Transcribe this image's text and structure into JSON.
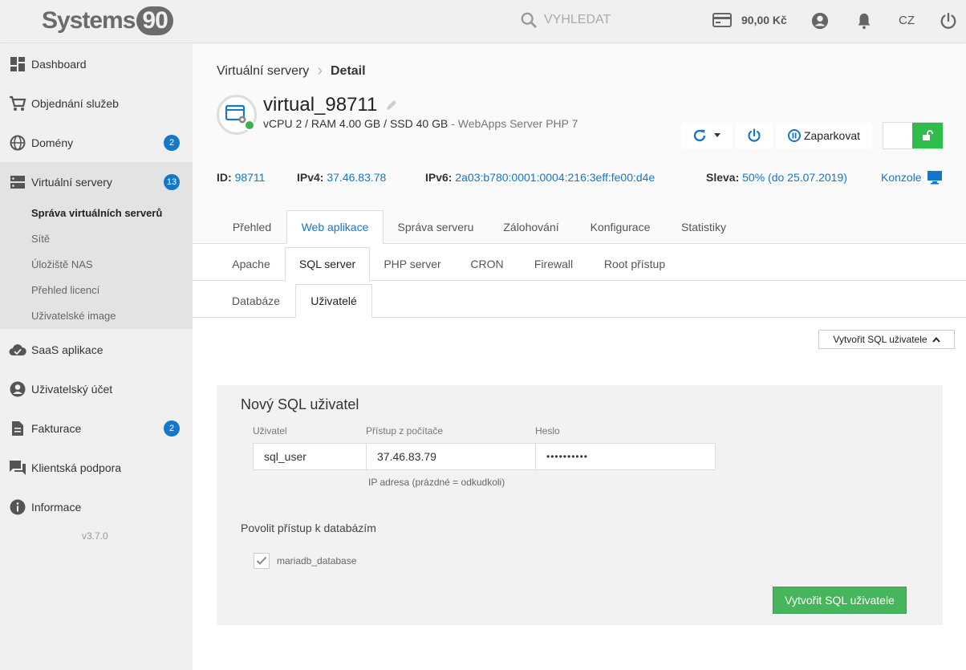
{
  "header": {
    "logo_text": "Systems",
    "logo_number": "90",
    "search_placeholder": "VYHLEDAT",
    "credit": "90,00 Kč",
    "language": "CZ"
  },
  "sidebar": {
    "items": [
      {
        "label": "Dashboard",
        "icon": "dashboard-icon"
      },
      {
        "label": "Objednání služeb",
        "icon": "cart-icon"
      },
      {
        "label": "Domény",
        "icon": "globe-icon",
        "badge": "2"
      },
      {
        "label": "Virtuální servery",
        "icon": "server-icon",
        "badge": "13"
      },
      {
        "label": "SaaS aplikace",
        "icon": "cloud-check-icon"
      },
      {
        "label": "Uživatelský účet",
        "icon": "user-icon"
      },
      {
        "label": "Fakturace",
        "icon": "document-icon",
        "badge": "2"
      },
      {
        "label": "Klientská podpora",
        "icon": "chat-icon"
      },
      {
        "label": "Informace",
        "icon": "info-icon"
      }
    ],
    "subitems": [
      {
        "label": "Správa virtuálních serverů",
        "active": true
      },
      {
        "label": "Sítě"
      },
      {
        "label": "Úložiště NAS"
      },
      {
        "label": "Přehled licencí"
      },
      {
        "label": "Uživatelské image"
      }
    ],
    "version": "v3.7.0"
  },
  "breadcrumb": {
    "parent": "Virtuální servery",
    "current": "Detail"
  },
  "server": {
    "name": "virtual_98711",
    "specs": "vCPU 2 / RAM 4.00 GB / SSD 40 GB",
    "specs_suffix": " - WebApps Server PHP 7",
    "status_color": "#3cb04c"
  },
  "actions": {
    "park_label": "Zaparkovat"
  },
  "info": {
    "id_label": "ID:",
    "id_value": "98711",
    "ipv4_label": "IPv4:",
    "ipv4_value": "37.46.83.78",
    "ipv6_label": "IPv6:",
    "ipv6_value": "2a03:b780:0001:0004:216:3eff:fe00:d4e",
    "discount_label": "Sleva:",
    "discount_value": "50% (do 25.07.2019)",
    "console_label": "Konzole"
  },
  "tabs_main": [
    "Přehled",
    "Web aplikace",
    "Správa serveru",
    "Zálohování",
    "Konfigurace",
    "Statistiky"
  ],
  "tabs_sub": [
    "Apache",
    "SQL server",
    "PHP server",
    "CRON",
    "Firewall",
    "Root přístup"
  ],
  "tabs_third": [
    "Databáze",
    "Uživatelé"
  ],
  "create_toggle_label": "Vytvořit SQL uživatele",
  "form": {
    "title": "Nový SQL uživatel",
    "user_label": "Uživatel",
    "user_value": "sql_user",
    "host_label": "Přístup z počítače",
    "host_value": "37.46.83.79",
    "host_hint": "IP adresa (prázdné = odkudkoli)",
    "password_label": "Heslo",
    "password_value": "••••••••••",
    "permissions_title": "Povolit přístup k databázím",
    "database_option": "mariadb_database",
    "database_checked": true,
    "submit_label": "Vytvořit SQL uživatele"
  },
  "colors": {
    "accent": "#1477c9",
    "success": "#47b55b",
    "sidebar_bg": "#f0f0f0"
  }
}
